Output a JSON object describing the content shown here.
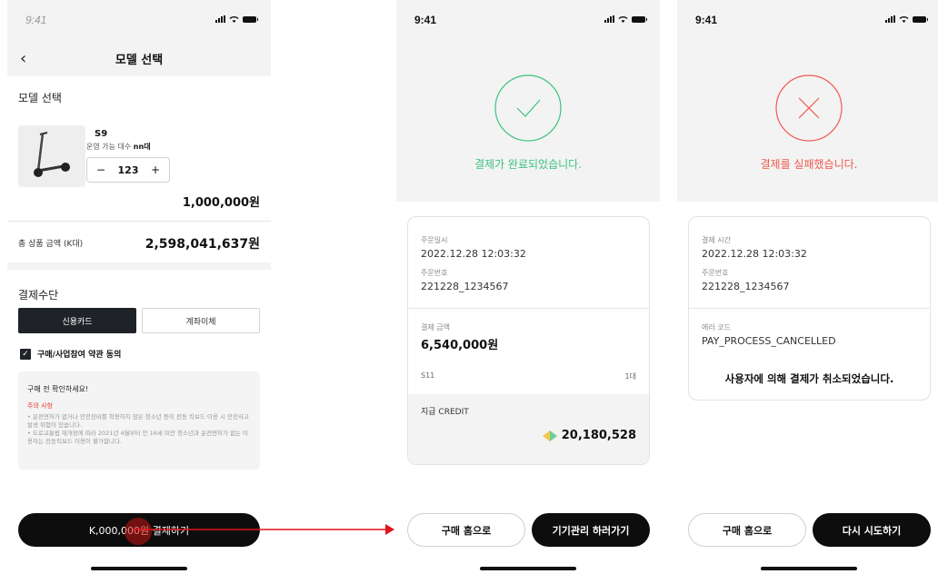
{
  "colors": {
    "success": "#3ac47d",
    "error": "#f15a4f",
    "arrow": "#e0141a",
    "dark": "#0d0d0d"
  },
  "screen1": {
    "status_time": "9:41",
    "nav_title": "모델 선택",
    "section_model": "모델 선택",
    "product_name": "S9",
    "product_desc": "운영 가능 대수",
    "product_desc_value": "nn대",
    "stepper": {
      "minus": "−",
      "quantity": "123",
      "plus": "+"
    },
    "price": "1,000,000원",
    "total_label": "총 상품 금액 (K대)",
    "total_value": "2,598,041,637원",
    "payment_title": "결제수단",
    "payment_options": [
      "신용카드",
      "계좌이체"
    ],
    "agree_label": "구매/사업참여 약관 동의",
    "notice": {
      "title": "구매 전 확인하세요!",
      "warn_title": "주의 사항",
      "line1": "• 운전면허가 없거나 안전장비를 착용하지 않은 청소년 등이 전동 킥보드 이용 시 안전사고 발생 위험이 있습니다.",
      "line2": "• 도로교통법 재개정에 따라 2021년 4월부터 만 16세 미만 청소년과 운전면허가 없는 이용자는 전동킥보드 이용이 불가합니다."
    },
    "pay_button": "K,000,000원 결제하기"
  },
  "screen2": {
    "status_time": "9:41",
    "result_text": "결제가 완료되었습니다.",
    "order_time_label": "주문일시",
    "order_time": "2022.12.28 12:03:32",
    "order_no_label": "주문번호",
    "order_no": "221228_1234567",
    "amount_label": "결제 금액",
    "amount": "6,540,000원",
    "item_name": "S11",
    "item_qty": "1대",
    "credit_label": "지급 CREDIT",
    "credit_value": "20,180,528",
    "btn_home": "구매 홈으로",
    "btn_manage": "기기관리 하러가기"
  },
  "screen3": {
    "status_time": "9:41",
    "result_text": "결제를 실패했습니다.",
    "pay_time_label": "결제 시간",
    "pay_time": "2022.12.28 12:03:32",
    "order_no_label": "주문번호",
    "order_no": "221228_1234567",
    "error_label": "에러 코드",
    "error_code": "PAY_PROCESS_CANCELLED",
    "error_message": "사용자에 의해 결제가 취소되었습니다.",
    "btn_home": "구매 홈으로",
    "btn_retry": "다시 시도하기"
  }
}
